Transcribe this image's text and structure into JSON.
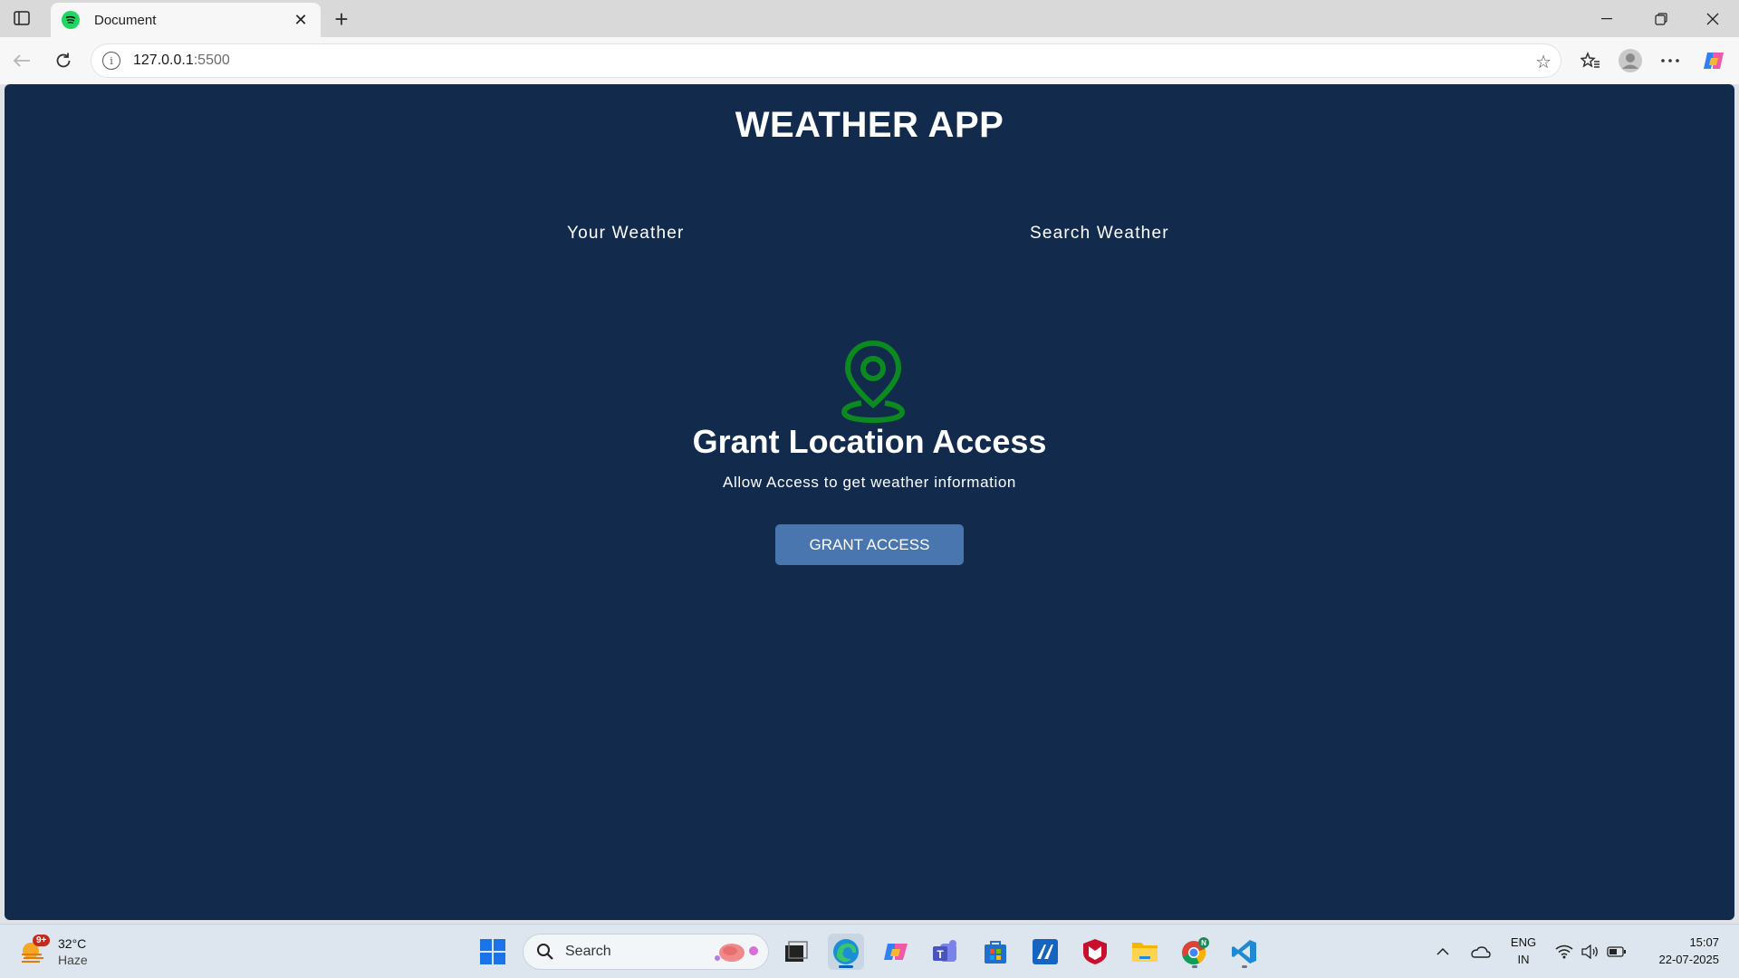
{
  "browser": {
    "tab_title": "Document",
    "url_host": "127.0.0.1",
    "url_port": ":5500",
    "icons": [
      "tab-actions-icon",
      "spotify-favicon",
      "close-icon",
      "plus-icon",
      "minimize-icon",
      "restore-icon",
      "window-close-icon",
      "back-icon",
      "reload-icon",
      "site-info-icon",
      "star-icon",
      "favorites-icon",
      "profile-icon",
      "more-icon",
      "copilot-icon"
    ]
  },
  "page": {
    "app_title": "WEATHER APP",
    "tabs": [
      {
        "label": "Your Weather"
      },
      {
        "label": "Search Weather"
      }
    ],
    "grant": {
      "title": "Grant Location Access",
      "subtitle": "Allow Access to get weather information",
      "button_label": "GRANT ACCESS"
    },
    "colors": {
      "background": "#122b4d",
      "location_icon": "#0a8a1f",
      "button": "#4a76b0"
    }
  },
  "taskbar": {
    "weather": {
      "badge": "9+",
      "temp": "32°C",
      "condition": "Haze"
    },
    "search_placeholder": "Search",
    "apps": [
      "windows-start-icon",
      "search-icon",
      "task-view-icon",
      "edge-icon",
      "copilot-icon",
      "teams-icon",
      "store-icon",
      "app-icon",
      "mcafee-icon",
      "file-explorer-icon",
      "chrome-icon",
      "vscode-icon"
    ],
    "tray": {
      "lang_line1": "ENG",
      "lang_line2": "IN",
      "time": "15:07",
      "date": "22-07-2025"
    }
  }
}
